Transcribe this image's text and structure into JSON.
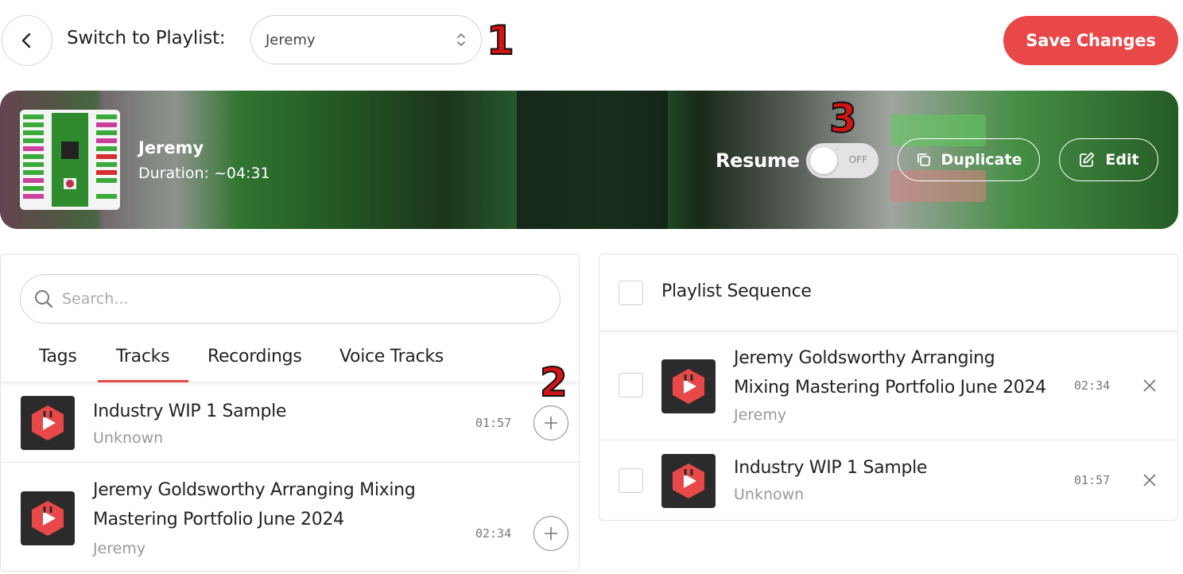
{
  "header": {
    "switch_label": "Switch to Playlist:",
    "selected_playlist": "Jeremy",
    "save_label": "Save Changes",
    "annotation_1": "1",
    "annotation_2": "2",
    "annotation_3": "3"
  },
  "playlist": {
    "name": "Jeremy",
    "duration": "Duration: ~04:31",
    "resume_label": "Resume",
    "resume_state": "OFF",
    "duplicate_label": "Duplicate",
    "edit_label": "Edit"
  },
  "library": {
    "search_placeholder": "Search...",
    "tabs": [
      "Tags",
      "Tracks",
      "Recordings",
      "Voice Tracks"
    ],
    "active_tab": "Tracks",
    "tracks": [
      {
        "title": "Industry WIP 1 Sample",
        "artist": "Unknown",
        "duration": "01:57"
      },
      {
        "title_line1": "Jeremy Goldsworthy Arranging Mixing",
        "title_line2": "Mastering Portfolio June 2024",
        "artist": "Jeremy",
        "duration": "02:34"
      }
    ]
  },
  "sequence": {
    "title": "Playlist Sequence",
    "items": [
      {
        "title_line1": "Jeremy Goldsworthy Arranging",
        "title_line2": "Mixing Mastering Portfolio June 2024",
        "artist": "Jeremy",
        "duration": "02:34"
      },
      {
        "title": "Industry WIP 1 Sample",
        "artist": "Unknown",
        "duration": "01:57"
      }
    ]
  },
  "colors": {
    "accent": "#e84848",
    "annotation": "#d41414",
    "track_icon_bg": "#2b2b2b"
  },
  "icons": {
    "back": "chevron-left-icon",
    "select": "up-down-chevron-icon",
    "search": "search-icon",
    "duplicate": "copy-icon",
    "edit": "pencil-icon",
    "add": "plus-icon",
    "remove": "close-icon",
    "track": "play-logo-icon"
  }
}
